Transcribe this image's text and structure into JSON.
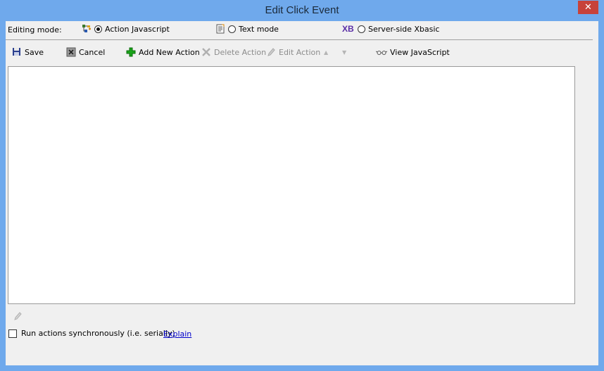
{
  "window": {
    "title": "Edit Click Event",
    "close_glyph": "✕"
  },
  "mode": {
    "label": "Editing mode:",
    "options": [
      {
        "icon": "action-tree-icon",
        "label": "Action Javascript",
        "selected": true
      },
      {
        "icon": "text-doc-icon",
        "label": "Text mode",
        "selected": false
      },
      {
        "icon": "xb-icon",
        "icon_text": "XB",
        "label": "Server-side Xbasic",
        "selected": false
      }
    ]
  },
  "toolbar": {
    "save": "Save",
    "cancel": "Cancel",
    "add": "Add New Action",
    "delete": "Delete Action",
    "edit": "Edit Action",
    "view_js": "View JavaScript",
    "move_up_glyph": "▲",
    "move_down_glyph": "▼"
  },
  "footer": {
    "sync_label": "Run actions synchronously (i.e. serially)",
    "sync_checked": false,
    "explain": "Explain"
  },
  "colors": {
    "titlebar": "#6fa9ec",
    "close": "#c7423a",
    "xb": "#5a2ea6",
    "add": "#1aa51a",
    "link": "#0000cc"
  }
}
